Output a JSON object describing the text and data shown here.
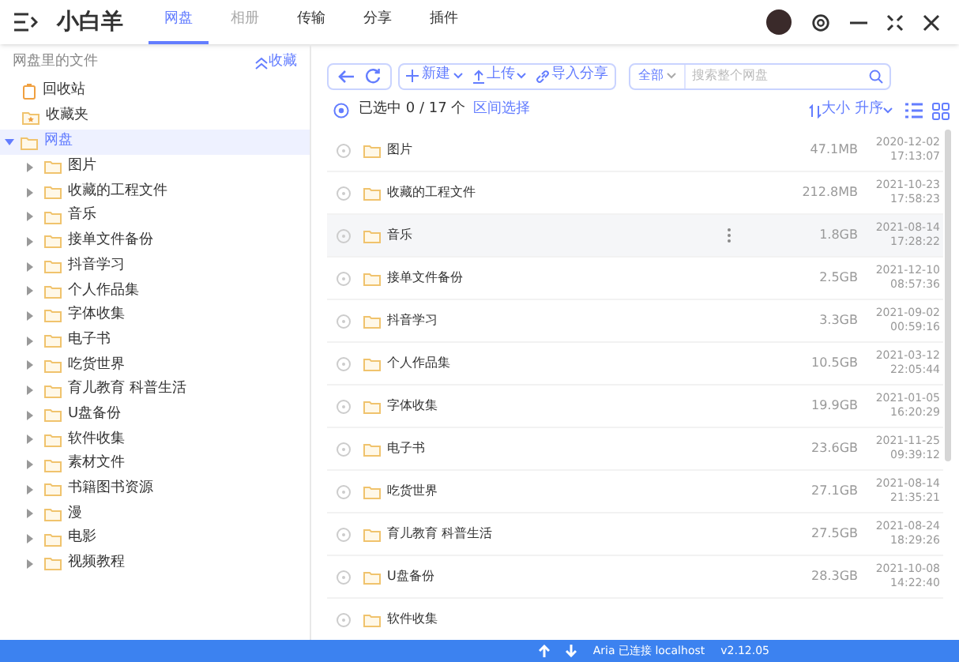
{
  "app": {
    "title": "小白羊"
  },
  "tabs": [
    {
      "label": "网盘",
      "selected": true,
      "disabled": false
    },
    {
      "label": "相册",
      "selected": false,
      "disabled": true
    },
    {
      "label": "传输",
      "selected": false,
      "disabled": false
    },
    {
      "label": "分享",
      "selected": false,
      "disabled": false
    },
    {
      "label": "插件",
      "selected": false,
      "disabled": false
    }
  ],
  "sidebar": {
    "heading": "网盘里的文件",
    "collapse_button": "收藏",
    "items": [
      {
        "label": "回收站",
        "kind": "trash",
        "selected": false
      },
      {
        "label": "收藏夹",
        "kind": "favorites",
        "selected": false
      },
      {
        "label": "网盘",
        "kind": "folder",
        "selected": true,
        "expanded": true,
        "children": [
          {
            "label": "图片",
            "expanded": false
          },
          {
            "label": "收藏的工程文件",
            "expanded": false
          },
          {
            "label": "音乐",
            "expanded": false
          },
          {
            "label": "接单文件备份",
            "expanded": false
          },
          {
            "label": "抖音学习",
            "expanded": false
          },
          {
            "label": "个人作品集",
            "expanded": false
          },
          {
            "label": "字体收集",
            "expanded": false
          },
          {
            "label": "电子书",
            "expanded": false
          },
          {
            "label": "吃货世界",
            "expanded": false
          },
          {
            "label": "育儿教育 科普生活",
            "expanded": false
          },
          {
            "label": "U盘备份",
            "expanded": false
          },
          {
            "label": "软件收集",
            "expanded": false
          },
          {
            "label": "素材文件",
            "expanded": false
          },
          {
            "label": "书籍图书资源",
            "expanded": false
          },
          {
            "label": "漫",
            "expanded": false
          },
          {
            "label": "电影",
            "expanded": false
          },
          {
            "label": "视频教程",
            "expanded": false
          }
        ]
      }
    ]
  },
  "toolbar": {
    "new_button": "新建",
    "upload_button": "上传",
    "import_button": "导入分享",
    "scope": "全部",
    "search_placeholder": "搜索整个网盘"
  },
  "selection": {
    "count": "已选中 0 / 17 个",
    "range_link": "区间选择",
    "sort": "大小 升序"
  },
  "files": [
    {
      "name": "图片",
      "size": "47.1MB",
      "date": "2020-12-02",
      "time": "17:13:07",
      "hovered": false
    },
    {
      "name": "收藏的工程文件",
      "size": "212.8MB",
      "date": "2021-10-23",
      "time": "17:58:23",
      "hovered": false
    },
    {
      "name": "音乐",
      "size": "1.8GB",
      "date": "2021-08-14",
      "time": "17:28:22",
      "hovered": true
    },
    {
      "name": "接单文件备份",
      "size": "2.5GB",
      "date": "2021-12-10",
      "time": "08:57:36",
      "hovered": false
    },
    {
      "name": "抖音学习",
      "size": "3.3GB",
      "date": "2021-09-02",
      "time": "00:59:16",
      "hovered": false
    },
    {
      "name": "个人作品集",
      "size": "10.5GB",
      "date": "2021-03-12",
      "time": "22:05:44",
      "hovered": false
    },
    {
      "name": "字体收集",
      "size": "19.9GB",
      "date": "2021-01-05",
      "time": "16:20:29",
      "hovered": false
    },
    {
      "name": "电子书",
      "size": "23.6GB",
      "date": "2021-11-25",
      "time": "09:39:12",
      "hovered": false
    },
    {
      "name": "吃货世界",
      "size": "27.1GB",
      "date": "2021-08-14",
      "time": "21:35:21",
      "hovered": false
    },
    {
      "name": "育儿教育 科普生活",
      "size": "27.5GB",
      "date": "2021-08-24",
      "time": "18:29:26",
      "hovered": false
    },
    {
      "name": "U盘备份",
      "size": "28.3GB",
      "date": "2021-10-08",
      "time": "14:22:40",
      "hovered": false
    },
    {
      "name": "软件收集",
      "hovered": false
    }
  ],
  "status_bar": {
    "aria": "Aria 已连接 localhost",
    "version": "v2.12.05"
  }
}
